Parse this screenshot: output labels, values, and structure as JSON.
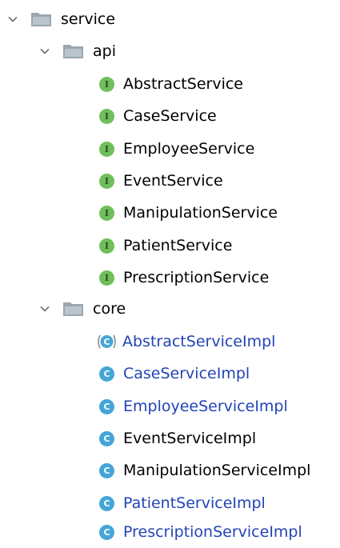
{
  "tree": {
    "service": {
      "label": "service"
    },
    "api": {
      "label": "api",
      "items": [
        "AbstractService",
        "CaseService",
        "EmployeeService",
        "EventService",
        "ManipulationService",
        "PatientService",
        "PrescriptionService"
      ]
    },
    "core": {
      "label": "core",
      "items": [
        {
          "label": "AbstractServiceImpl",
          "kind": "abstract-class",
          "color": "blue"
        },
        {
          "label": "CaseServiceImpl",
          "kind": "class",
          "color": "blue"
        },
        {
          "label": "EmployeeServiceImpl",
          "kind": "class",
          "color": "blue"
        },
        {
          "label": "EventServiceImpl",
          "kind": "class",
          "color": "black"
        },
        {
          "label": "ManipulationServiceImpl",
          "kind": "class",
          "color": "black"
        },
        {
          "label": "PatientServiceImpl",
          "kind": "class",
          "color": "blue"
        },
        {
          "label": "PrescriptionServiceImpl",
          "kind": "class",
          "color": "blue"
        }
      ]
    }
  },
  "icons": {
    "chevron": "chevron-down-icon",
    "package": "folder-icon",
    "interface_letter": "I",
    "class_letter": "C"
  },
  "colors": {
    "interface_icon": "#6fbf5a",
    "class_icon": "#45a6d6",
    "modified_text": "#2243b6",
    "folder": "#9aa7b0"
  }
}
